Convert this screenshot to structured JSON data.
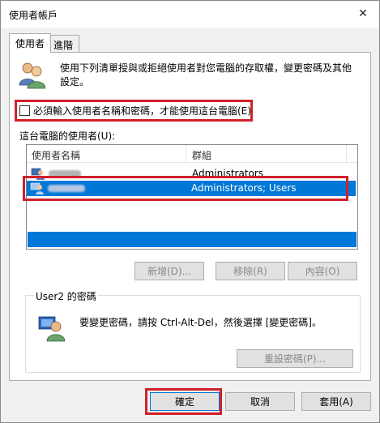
{
  "window": {
    "title": "使用者帳戶",
    "close_glyph": "✕"
  },
  "tabs": [
    {
      "label": "使用者",
      "active": true
    },
    {
      "label": "進階",
      "active": false
    }
  ],
  "intro_text": "使用下列清單授與或拒絕使用者對您電腦的存取權，變更密碼及其他設定。",
  "checkbox": {
    "label": "必須輸入使用者名稱和密碼，才能使用這台電腦(E)",
    "checked": false
  },
  "users_list": {
    "label": "這台電腦的使用者(U):",
    "columns": [
      "使用者名稱",
      "群組"
    ],
    "rows": [
      {
        "name": "",
        "group": "Administrators",
        "selected": false
      },
      {
        "name": "",
        "group": "Administrators; Users",
        "selected": true
      }
    ]
  },
  "list_buttons": {
    "add": "新增(D)...",
    "remove": "移除(R)",
    "properties": "內容(O)"
  },
  "password_group": {
    "legend": "User2 的密碼",
    "text": "要變更密碼，請按 Ctrl-Alt-Del，然後選擇 [變更密碼]。",
    "reset_button": "重設密碼(P)..."
  },
  "footer_buttons": {
    "ok": "確定",
    "cancel": "取消",
    "apply": "套用(A)"
  },
  "colors": {
    "selection": "#0078d7",
    "annotation": "#d0202a"
  },
  "icons": {
    "users": "users-icon",
    "user_row": "user-row-icon",
    "key_user": "user-key-icon"
  }
}
